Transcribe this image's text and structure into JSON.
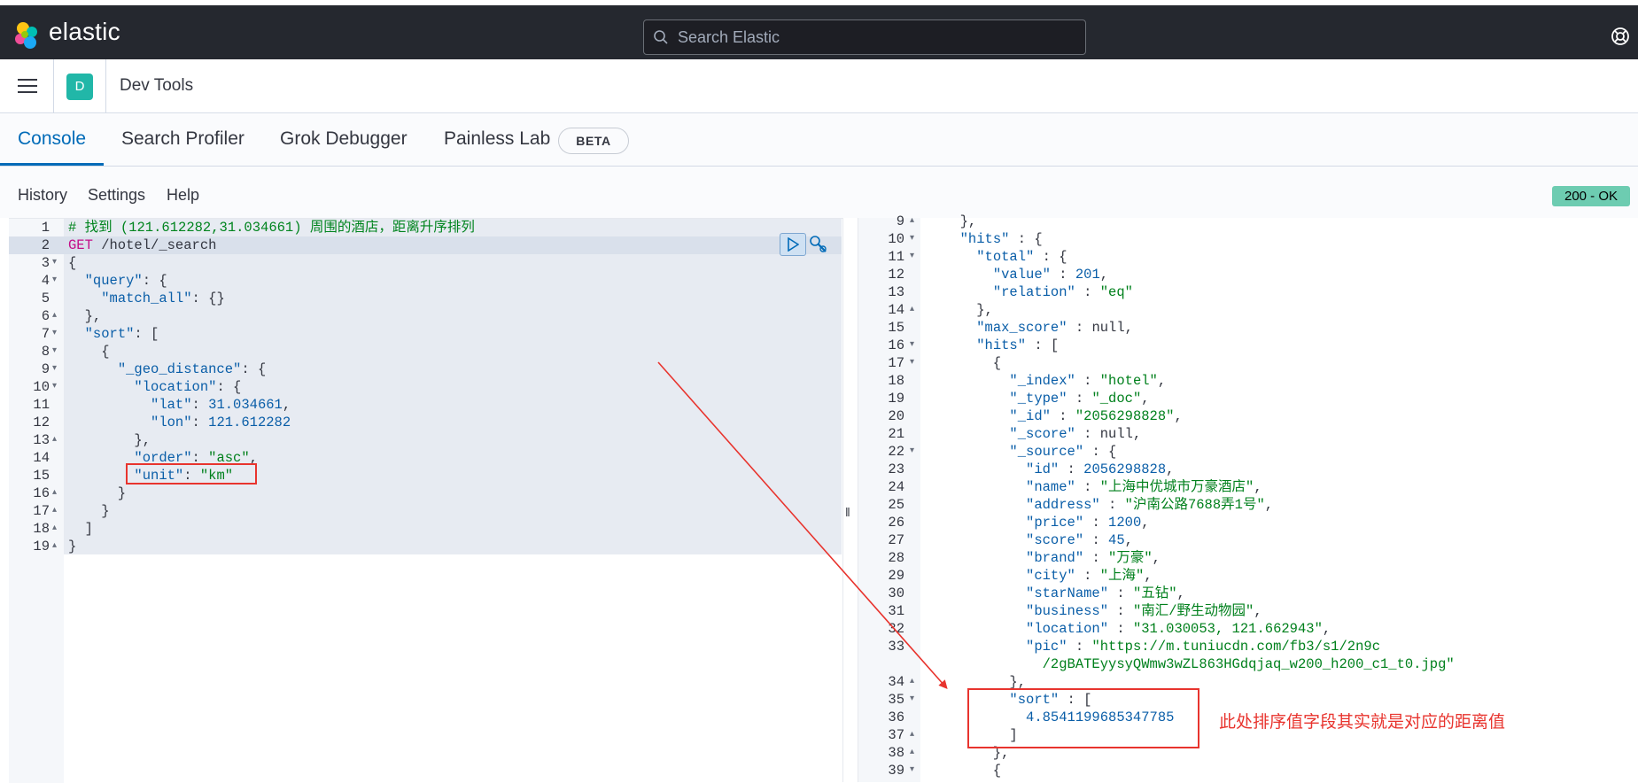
{
  "topbar": {
    "brand": "elastic",
    "search_placeholder": "Search Elastic",
    "help_icon": "help-icon"
  },
  "header": {
    "space_initial": "D",
    "page_title": "Dev Tools"
  },
  "tabs": [
    {
      "label": "Console",
      "active": true
    },
    {
      "label": "Search Profiler"
    },
    {
      "label": "Grok Debugger"
    },
    {
      "label": "Painless Lab"
    }
  ],
  "beta_badge": "BETA",
  "toolbar": {
    "history": "History",
    "settings": "Settings",
    "help": "Help",
    "status": "200 - OK"
  },
  "request_lines": [
    {
      "n": "1",
      "f": "",
      "t": [
        [
          "tk-c",
          "# 找到 (121.612282,31.034661) 周围的酒店，距离升序排列"
        ]
      ]
    },
    {
      "n": "2",
      "f": "",
      "t": [
        [
          "tk-k",
          "GET"
        ],
        [
          "tk-p",
          " /hotel/_search"
        ]
      ]
    },
    {
      "n": "3",
      "f": "▾",
      "t": [
        [
          "tk-p",
          "{"
        ]
      ]
    },
    {
      "n": "4",
      "f": "▾",
      "t": [
        [
          "tk-p",
          "  "
        ],
        [
          "tk-key",
          "\"query\""
        ],
        [
          "tk-p",
          ": {"
        ]
      ]
    },
    {
      "n": "5",
      "f": "",
      "t": [
        [
          "tk-p",
          "    "
        ],
        [
          "tk-key",
          "\"match_all\""
        ],
        [
          "tk-p",
          ": {}"
        ]
      ]
    },
    {
      "n": "6",
      "f": "▴",
      "t": [
        [
          "tk-p",
          "  },"
        ]
      ]
    },
    {
      "n": "7",
      "f": "▾",
      "t": [
        [
          "tk-p",
          "  "
        ],
        [
          "tk-key",
          "\"sort\""
        ],
        [
          "tk-p",
          ": ["
        ]
      ]
    },
    {
      "n": "8",
      "f": "▾",
      "t": [
        [
          "tk-p",
          "    {"
        ]
      ]
    },
    {
      "n": "9",
      "f": "▾",
      "t": [
        [
          "tk-p",
          "      "
        ],
        [
          "tk-key",
          "\"_geo_distance\""
        ],
        [
          "tk-p",
          ": {"
        ]
      ]
    },
    {
      "n": "10",
      "f": "▾",
      "t": [
        [
          "tk-p",
          "        "
        ],
        [
          "tk-key",
          "\"location\""
        ],
        [
          "tk-p",
          ": {"
        ]
      ]
    },
    {
      "n": "11",
      "f": "",
      "t": [
        [
          "tk-p",
          "          "
        ],
        [
          "tk-key",
          "\"lat\""
        ],
        [
          "tk-p",
          ": "
        ],
        [
          "tk-n",
          "31.034661"
        ],
        [
          "tk-p",
          ","
        ]
      ]
    },
    {
      "n": "12",
      "f": "",
      "t": [
        [
          "tk-p",
          "          "
        ],
        [
          "tk-key",
          "\"lon\""
        ],
        [
          "tk-p",
          ": "
        ],
        [
          "tk-n",
          "121.612282"
        ]
      ]
    },
    {
      "n": "13",
      "f": "▴",
      "t": [
        [
          "tk-p",
          "        },"
        ]
      ]
    },
    {
      "n": "14",
      "f": "",
      "t": [
        [
          "tk-p",
          "        "
        ],
        [
          "tk-key",
          "\"order\""
        ],
        [
          "tk-p",
          ": "
        ],
        [
          "tk-s",
          "\"asc\""
        ],
        [
          "tk-p",
          ","
        ]
      ]
    },
    {
      "n": "15",
      "f": "",
      "t": [
        [
          "tk-p",
          "        "
        ],
        [
          "tk-key",
          "\"unit\""
        ],
        [
          "tk-p",
          ": "
        ],
        [
          "tk-s",
          "\"km\""
        ]
      ]
    },
    {
      "n": "16",
      "f": "▴",
      "t": [
        [
          "tk-p",
          "      }"
        ]
      ]
    },
    {
      "n": "17",
      "f": "▴",
      "t": [
        [
          "tk-p",
          "    }"
        ]
      ]
    },
    {
      "n": "18",
      "f": "▴",
      "t": [
        [
          "tk-p",
          "  ]"
        ]
      ]
    },
    {
      "n": "19",
      "f": "▴",
      "t": [
        [
          "tk-p",
          "}"
        ]
      ]
    }
  ],
  "response_lines": [
    {
      "n": "9",
      "f": "▴",
      "t": [
        [
          "tk-p",
          "  },"
        ]
      ]
    },
    {
      "n": "10",
      "f": "▾",
      "t": [
        [
          "tk-p",
          "  "
        ],
        [
          "tk-key",
          "\"hits\""
        ],
        [
          "tk-p",
          " : {"
        ]
      ]
    },
    {
      "n": "11",
      "f": "▾",
      "t": [
        [
          "tk-p",
          "    "
        ],
        [
          "tk-key",
          "\"total\""
        ],
        [
          "tk-p",
          " : {"
        ]
      ]
    },
    {
      "n": "12",
      "f": "",
      "t": [
        [
          "tk-p",
          "      "
        ],
        [
          "tk-key",
          "\"value\""
        ],
        [
          "tk-p",
          " : "
        ],
        [
          "tk-n",
          "201"
        ],
        [
          "tk-p",
          ","
        ]
      ]
    },
    {
      "n": "13",
      "f": "",
      "t": [
        [
          "tk-p",
          "      "
        ],
        [
          "tk-key",
          "\"relation\""
        ],
        [
          "tk-p",
          " : "
        ],
        [
          "tk-s",
          "\"eq\""
        ]
      ]
    },
    {
      "n": "14",
      "f": "▴",
      "t": [
        [
          "tk-p",
          "    },"
        ]
      ]
    },
    {
      "n": "15",
      "f": "",
      "t": [
        [
          "tk-p",
          "    "
        ],
        [
          "tk-key",
          "\"max_score\""
        ],
        [
          "tk-p",
          " : "
        ],
        [
          "tk-null",
          "null"
        ],
        [
          "tk-p",
          ","
        ]
      ]
    },
    {
      "n": "16",
      "f": "▾",
      "t": [
        [
          "tk-p",
          "    "
        ],
        [
          "tk-key",
          "\"hits\""
        ],
        [
          "tk-p",
          " : ["
        ]
      ]
    },
    {
      "n": "17",
      "f": "▾",
      "t": [
        [
          "tk-p",
          "      {"
        ]
      ]
    },
    {
      "n": "18",
      "f": "",
      "t": [
        [
          "tk-p",
          "        "
        ],
        [
          "tk-key",
          "\"_index\""
        ],
        [
          "tk-p",
          " : "
        ],
        [
          "tk-s",
          "\"hotel\""
        ],
        [
          "tk-p",
          ","
        ]
      ]
    },
    {
      "n": "19",
      "f": "",
      "t": [
        [
          "tk-p",
          "        "
        ],
        [
          "tk-key",
          "\"_type\""
        ],
        [
          "tk-p",
          " : "
        ],
        [
          "tk-s",
          "\"_doc\""
        ],
        [
          "tk-p",
          ","
        ]
      ]
    },
    {
      "n": "20",
      "f": "",
      "t": [
        [
          "tk-p",
          "        "
        ],
        [
          "tk-key",
          "\"_id\""
        ],
        [
          "tk-p",
          " : "
        ],
        [
          "tk-s",
          "\"2056298828\""
        ],
        [
          "tk-p",
          ","
        ]
      ]
    },
    {
      "n": "21",
      "f": "",
      "t": [
        [
          "tk-p",
          "        "
        ],
        [
          "tk-key",
          "\"_score\""
        ],
        [
          "tk-p",
          " : "
        ],
        [
          "tk-null",
          "null"
        ],
        [
          "tk-p",
          ","
        ]
      ]
    },
    {
      "n": "22",
      "f": "▾",
      "t": [
        [
          "tk-p",
          "        "
        ],
        [
          "tk-key",
          "\"_source\""
        ],
        [
          "tk-p",
          " : {"
        ]
      ]
    },
    {
      "n": "23",
      "f": "",
      "t": [
        [
          "tk-p",
          "          "
        ],
        [
          "tk-key",
          "\"id\""
        ],
        [
          "tk-p",
          " : "
        ],
        [
          "tk-n",
          "2056298828"
        ],
        [
          "tk-p",
          ","
        ]
      ]
    },
    {
      "n": "24",
      "f": "",
      "t": [
        [
          "tk-p",
          "          "
        ],
        [
          "tk-key",
          "\"name\""
        ],
        [
          "tk-p",
          " : "
        ],
        [
          "tk-s",
          "\"上海中优城市万豪酒店\""
        ],
        [
          "tk-p",
          ","
        ]
      ]
    },
    {
      "n": "25",
      "f": "",
      "t": [
        [
          "tk-p",
          "          "
        ],
        [
          "tk-key",
          "\"address\""
        ],
        [
          "tk-p",
          " : "
        ],
        [
          "tk-s",
          "\"沪南公路7688弄1号\""
        ],
        [
          "tk-p",
          ","
        ]
      ]
    },
    {
      "n": "26",
      "f": "",
      "t": [
        [
          "tk-p",
          "          "
        ],
        [
          "tk-key",
          "\"price\""
        ],
        [
          "tk-p",
          " : "
        ],
        [
          "tk-n",
          "1200"
        ],
        [
          "tk-p",
          ","
        ]
      ]
    },
    {
      "n": "27",
      "f": "",
      "t": [
        [
          "tk-p",
          "          "
        ],
        [
          "tk-key",
          "\"score\""
        ],
        [
          "tk-p",
          " : "
        ],
        [
          "tk-n",
          "45"
        ],
        [
          "tk-p",
          ","
        ]
      ]
    },
    {
      "n": "28",
      "f": "",
      "t": [
        [
          "tk-p",
          "          "
        ],
        [
          "tk-key",
          "\"brand\""
        ],
        [
          "tk-p",
          " : "
        ],
        [
          "tk-s",
          "\"万豪\""
        ],
        [
          "tk-p",
          ","
        ]
      ]
    },
    {
      "n": "29",
      "f": "",
      "t": [
        [
          "tk-p",
          "          "
        ],
        [
          "tk-key",
          "\"city\""
        ],
        [
          "tk-p",
          " : "
        ],
        [
          "tk-s",
          "\"上海\""
        ],
        [
          "tk-p",
          ","
        ]
      ]
    },
    {
      "n": "30",
      "f": "",
      "t": [
        [
          "tk-p",
          "          "
        ],
        [
          "tk-key",
          "\"starName\""
        ],
        [
          "tk-p",
          " : "
        ],
        [
          "tk-s",
          "\"五钻\""
        ],
        [
          "tk-p",
          ","
        ]
      ]
    },
    {
      "n": "31",
      "f": "",
      "t": [
        [
          "tk-p",
          "          "
        ],
        [
          "tk-key",
          "\"business\""
        ],
        [
          "tk-p",
          " : "
        ],
        [
          "tk-s",
          "\"南汇/野生动物园\""
        ],
        [
          "tk-p",
          ","
        ]
      ]
    },
    {
      "n": "32",
      "f": "",
      "t": [
        [
          "tk-p",
          "          "
        ],
        [
          "tk-key",
          "\"location\""
        ],
        [
          "tk-p",
          " : "
        ],
        [
          "tk-s",
          "\"31.030053, 121.662943\""
        ],
        [
          "tk-p",
          ","
        ]
      ]
    },
    {
      "n": "33",
      "f": "",
      "t": [
        [
          "tk-p",
          "          "
        ],
        [
          "tk-key",
          "\"pic\""
        ],
        [
          "tk-p",
          " : "
        ],
        [
          "tk-s",
          "\"https://m.tuniucdn.com/fb3/s1/2n9c"
        ]
      ]
    },
    {
      "n": "",
      "f": "",
      "t": [
        [
          "tk-s",
          "            /2gBATEyysyQWmw3wZL863HGdqjaq_w200_h200_c1_t0.jpg\""
        ]
      ]
    },
    {
      "n": "34",
      "f": "▴",
      "t": [
        [
          "tk-p",
          "        },"
        ]
      ]
    },
    {
      "n": "35",
      "f": "▾",
      "t": [
        [
          "tk-p",
          "        "
        ],
        [
          "tk-key",
          "\"sort\""
        ],
        [
          "tk-p",
          " : ["
        ]
      ]
    },
    {
      "n": "36",
      "f": "",
      "t": [
        [
          "tk-p",
          "          "
        ],
        [
          "tk-n",
          "4.8541199685347785"
        ]
      ]
    },
    {
      "n": "37",
      "f": "▴",
      "t": [
        [
          "tk-p",
          "        ]"
        ]
      ]
    },
    {
      "n": "38",
      "f": "▴",
      "t": [
        [
          "tk-p",
          "      },"
        ]
      ]
    },
    {
      "n": "39",
      "f": "▾",
      "t": [
        [
          "tk-p",
          "      {"
        ]
      ]
    }
  ],
  "annotation": {
    "note": "此处排序值字段其实就是对应的距离值",
    "color": "#e8342e"
  }
}
